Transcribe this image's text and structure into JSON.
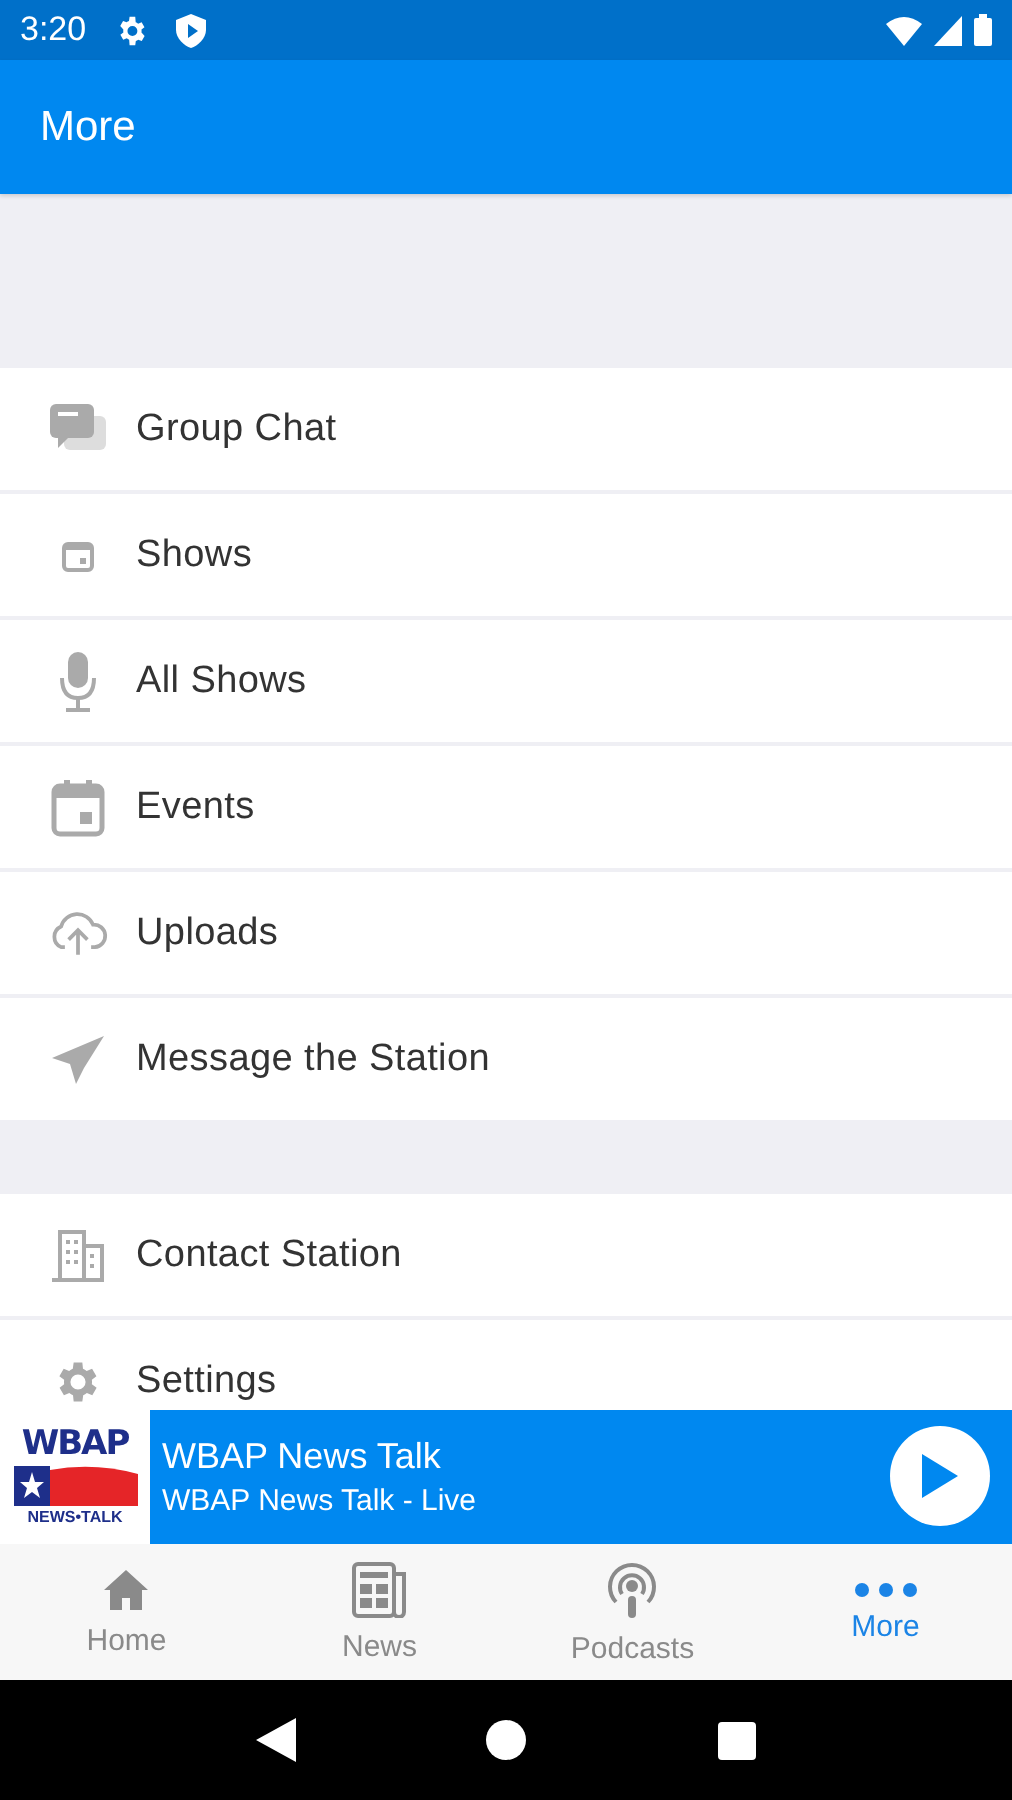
{
  "status_bar": {
    "time": "3:20"
  },
  "app_bar": {
    "title": "More"
  },
  "menu_groups": [
    [
      {
        "label": "Group Chat"
      },
      {
        "label": "Shows"
      },
      {
        "label": "All Shows"
      },
      {
        "label": "Events"
      },
      {
        "label": "Uploads"
      },
      {
        "label": "Message the Station"
      }
    ],
    [
      {
        "label": "Contact Station"
      },
      {
        "label": "Settings"
      }
    ]
  ],
  "player": {
    "logo": {
      "name": "WBAP",
      "tagline": "NEWS•TALK"
    },
    "title": "WBAP News Talk",
    "subtitle": "WBAP News Talk - Live"
  },
  "tabs": [
    {
      "label": "Home",
      "selected": false
    },
    {
      "label": "News",
      "selected": false
    },
    {
      "label": "Podcasts",
      "selected": false
    },
    {
      "label": "More",
      "selected": true
    }
  ]
}
